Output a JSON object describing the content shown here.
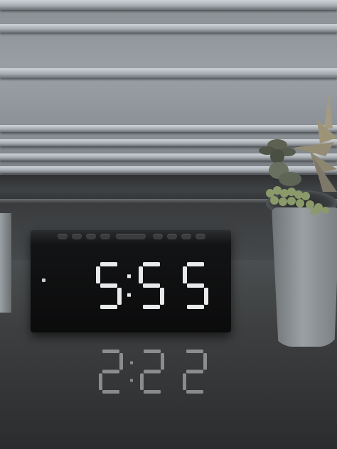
{
  "scene": {
    "description_label": "",
    "clock": {
      "time_digits": [
        "5",
        "5",
        "5"
      ],
      "reflection_digits": [
        "5",
        "5",
        "5"
      ],
      "led_color": "#e8eaec"
    },
    "colors": {
      "clock_body": "#0d0e0f",
      "blinds": "#b8bdc2",
      "pot": "#8e9397",
      "succulent": "#8a9a6a"
    }
  }
}
